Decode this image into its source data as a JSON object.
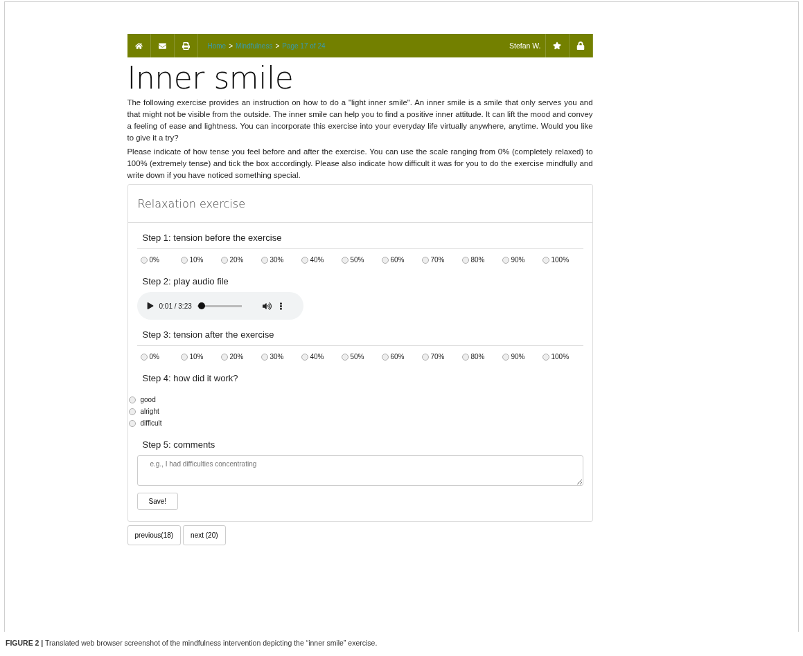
{
  "navbar": {
    "breadcrumb": [
      {
        "kind": "link",
        "text": "Home"
      },
      {
        "kind": "sep",
        "text": ">"
      },
      {
        "kind": "link",
        "text": "Mindfulness"
      },
      {
        "kind": "sep",
        "text": ">"
      },
      {
        "kind": "link",
        "text": "Page 17 of 24"
      }
    ],
    "user": "Stefan W."
  },
  "title": "Inner smile",
  "paragraphs": [
    "The following exercise provides an instruction on how to do a \"light inner smile\". An inner smile is a smile that only serves you and that might not be visible from the outside. The inner smile can help you to find a positive inner attitude. It can lift the mood and convey a feeling of ease and lightness. You can incorporate this exercise into your everyday life virtually anywhere, anytime. Would you like to give it a try?",
    "Please indicate of how tense you feel before and after the exercise. You can use the scale ranging from 0% (completely relaxed) to 100% (extremely tense) and tick the box accordingly. Please also indicate how difficult it was for you to do the exercise mindfully and write down if you have noticed something special."
  ],
  "card": {
    "title": "Relaxation exercise",
    "steps": [
      {
        "kind": "scale",
        "label": "Step 1: tension before the exercise",
        "options": [
          {
            "label": "0%",
            "selected": false
          },
          {
            "label": "10%",
            "selected": false
          },
          {
            "label": "20%",
            "selected": false
          },
          {
            "label": "30%",
            "selected": false
          },
          {
            "label": "40%",
            "selected": false
          },
          {
            "label": "50%",
            "selected": false
          },
          {
            "label": "60%",
            "selected": false
          },
          {
            "label": "70%",
            "selected": false
          },
          {
            "label": "80%",
            "selected": false
          },
          {
            "label": "90%",
            "selected": false
          },
          {
            "label": "100%",
            "selected": false
          }
        ]
      },
      {
        "kind": "audio",
        "label": "Step 2: play audio file",
        "time": "0:01 / 3:23",
        "level": 0.02
      },
      {
        "kind": "scale",
        "label": "Step 3: tension after the exercise",
        "options": [
          {
            "label": "0%",
            "selected": false
          },
          {
            "label": "10%",
            "selected": false
          },
          {
            "label": "20%",
            "selected": false
          },
          {
            "label": "30%",
            "selected": false
          },
          {
            "label": "40%",
            "selected": false
          },
          {
            "label": "50%",
            "selected": false
          },
          {
            "label": "60%",
            "selected": false
          },
          {
            "label": "70%",
            "selected": false
          },
          {
            "label": "80%",
            "selected": false
          },
          {
            "label": "90%",
            "selected": false
          },
          {
            "label": "100%",
            "selected": false
          }
        ]
      },
      {
        "kind": "choice",
        "label": "Step 4: how did it work?",
        "options": [
          {
            "label": "good",
            "selected": false
          },
          {
            "label": "alright",
            "selected": false
          },
          {
            "label": "difficult",
            "selected": false
          }
        ]
      },
      {
        "kind": "comments",
        "label": "Step 5: comments",
        "placeholder": "e.g., I had difficulties concentrating",
        "button": "Save!"
      }
    ]
  },
  "pager": [
    "previous(18)",
    "next (20)"
  ],
  "caption": "**FIGURE 2 |** Translated web browser screenshot of the mindfulness intervention depicting the “inner smile” exercise."
}
